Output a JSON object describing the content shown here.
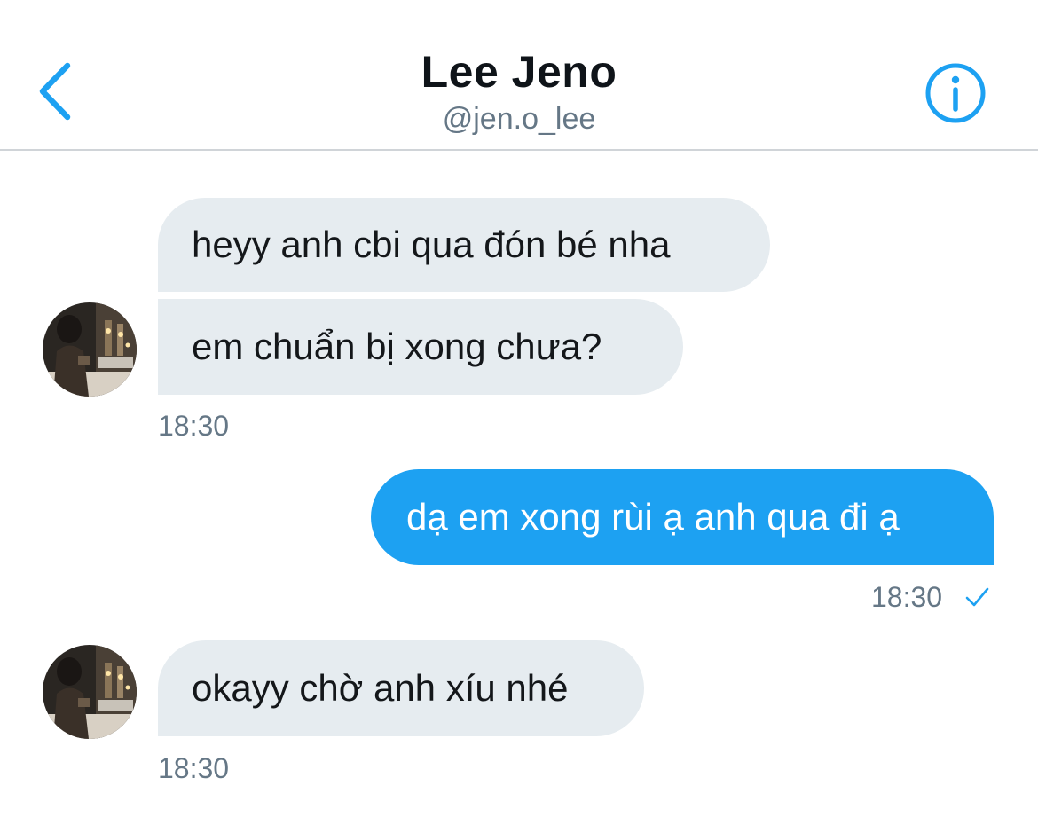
{
  "header": {
    "title": "Lee Jeno",
    "handle": "@jen.o_lee",
    "back_icon": "chevron-left-icon",
    "info_icon": "info-icon"
  },
  "messages": [
    {
      "direction": "incoming",
      "text": "heyy anh cbi qua đón bé nha"
    },
    {
      "direction": "incoming",
      "text": "em chuẩn bị xong chưa?",
      "time": "18:30"
    },
    {
      "direction": "outgoing",
      "text": "dạ em xong rùi ạ anh qua đi ạ",
      "time": "18:30",
      "status_icon": "checkmark-icon"
    },
    {
      "direction": "incoming",
      "text": "okayy chờ anh xíu nhé",
      "time": "18:30"
    }
  ],
  "colors": {
    "accent": "#1da1f2",
    "incoming_bubble": "#e6ecf0",
    "secondary_text": "#657786",
    "primary_text": "#14171a"
  }
}
